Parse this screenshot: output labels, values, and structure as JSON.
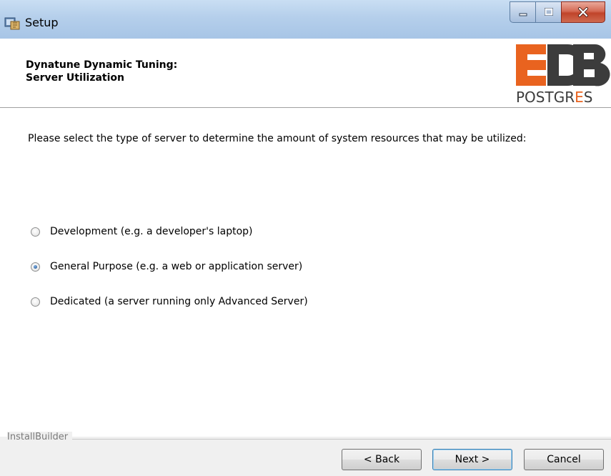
{
  "window": {
    "title": "Setup",
    "controls": {
      "minimize": "minimize",
      "maximize": "maximize",
      "close": "x"
    }
  },
  "header": {
    "title_line1": "Dynatune Dynamic Tuning:",
    "title_line2": "Server Utilization",
    "logo": {
      "top": "EDB",
      "bottom_prefix": "POSTGR",
      "bottom_accent": "E",
      "bottom_suffix": "S"
    }
  },
  "content": {
    "prompt": "Please select the type of server to determine the amount of system resources that may be utilized:",
    "options": [
      {
        "label": "Development (e.g. a developer's laptop)",
        "selected": false
      },
      {
        "label": "General Purpose (e.g. a web or application server)",
        "selected": true
      },
      {
        "label": "Dedicated (a server running only Advanced Server)",
        "selected": false
      }
    ]
  },
  "footer": {
    "brand": "InstallBuilder",
    "back_label": "< Back",
    "next_label": "Next >",
    "cancel_label": "Cancel"
  },
  "colors": {
    "logo_orange": "#e9631f",
    "logo_dark": "#3c3c3c",
    "titlebar": "#b5cfeb",
    "close": "#c0442a"
  }
}
